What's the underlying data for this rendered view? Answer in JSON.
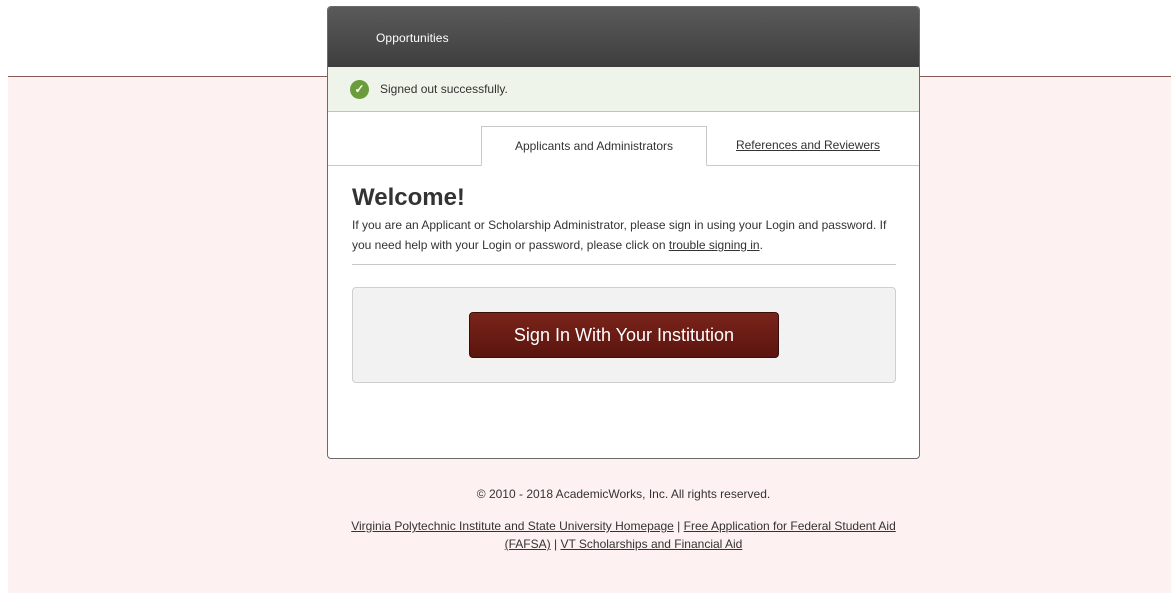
{
  "header": {
    "title": "Opportunities"
  },
  "alert": {
    "message": "Signed out successfully."
  },
  "tabs": [
    {
      "label": "Applicants and Administrators",
      "active": true
    },
    {
      "label": "References and Reviewers",
      "active": false
    }
  ],
  "welcome": {
    "heading": "Welcome!",
    "intro_text": "If you are an Applicant or Scholarship Administrator, please sign in using your Login and password. If you need help with your Login or password, please click on ",
    "help_link": "trouble signing in",
    "intro_end": "."
  },
  "signin": {
    "button_label": "Sign In With Your Institution"
  },
  "footer": {
    "copyright": "© 2010 - 2018 AcademicWorks, Inc. All rights reserved.",
    "link1": "Virginia Polytechnic Institute and State University Homepage",
    "sep": " | ",
    "link2": "Free Application for Federal Student Aid (FAFSA)",
    "link3": "VT Scholarships and Financial Aid"
  },
  "colors": {
    "header_bg": "#4a4a4a",
    "success_icon": "#6a9c3b",
    "signin_button": "#6b1c14",
    "page_band": "#fdf2f1"
  },
  "icons": {
    "alert_icon": "check-circle-icon"
  }
}
